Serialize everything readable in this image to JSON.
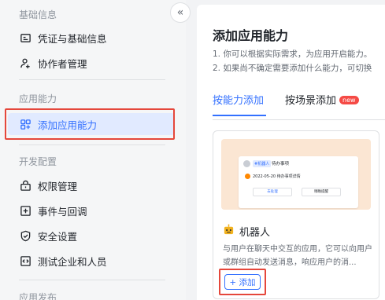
{
  "sidebar": {
    "groups": [
      {
        "title": "基础信息",
        "items": [
          {
            "label": "凭证与基础信息",
            "icon": "credential-icon"
          },
          {
            "label": "协作者管理",
            "icon": "user-add-icon"
          }
        ]
      },
      {
        "title": "应用能力",
        "items": [
          {
            "label": "添加应用能力",
            "icon": "add-capability-icon",
            "active": true
          }
        ]
      },
      {
        "title": "开发配置",
        "items": [
          {
            "label": "权限管理",
            "icon": "permission-icon"
          },
          {
            "label": "事件与回调",
            "icon": "event-icon"
          },
          {
            "label": "安全设置",
            "icon": "shield-icon"
          },
          {
            "label": "测试企业和人员",
            "icon": "code-icon"
          }
        ]
      },
      {
        "title": "应用发布",
        "items": []
      }
    ],
    "collapse_glyph": "«"
  },
  "main": {
    "title": "添加应用能力",
    "desc_line1": "1. 你可以根据实际需求，为应用开启能力。",
    "desc_line2": "2. 如果尚不确定需要添加什么能力，可切换",
    "tabs": [
      {
        "label": "按能力添加",
        "active": true
      },
      {
        "label": "按场景添加",
        "badge": "new"
      }
    ],
    "card": {
      "preview": {
        "tag": "#机器人",
        "name": "待办事项",
        "line": "2022-05-20 待办事项详情",
        "btn_left": "去处理",
        "btn_right": "稍晚提醒"
      },
      "title": "机器人",
      "description": "与用户在聊天中交互的应用，它可以向用户或群组自动发送消息，响应用户的消...",
      "add_label": "+ 添加"
    }
  },
  "colors": {
    "accent": "#3370ff",
    "highlight": "#e5473b",
    "badge": "#f54a45",
    "preview_bg": "#fbe6d3"
  }
}
